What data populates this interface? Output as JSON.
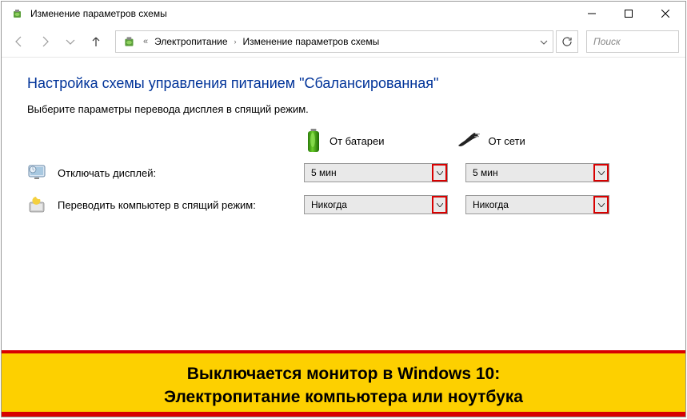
{
  "window": {
    "title": "Изменение параметров схемы"
  },
  "breadcrumb": {
    "item1": "Электропитание",
    "item2": "Изменение параметров схемы"
  },
  "search": {
    "placeholder": "Поиск"
  },
  "page": {
    "heading": "Настройка схемы управления питанием \"Сбалансированная\"",
    "subtext": "Выберите параметры перевода дисплея в спящий режим."
  },
  "columns": {
    "battery": "От батареи",
    "plugged": "От сети"
  },
  "settings": {
    "display_off": {
      "label": "Отключать дисплей:",
      "battery_value": "5 мин",
      "plugged_value": "5 мин"
    },
    "sleep": {
      "label": "Переводить компьютер в спящий режим:",
      "battery_value": "Никогда",
      "plugged_value": "Никогда"
    }
  },
  "banner": {
    "line1": "Выключается монитор в Windows 10:",
    "line2": "Электропитание компьютера или ноутбука"
  }
}
